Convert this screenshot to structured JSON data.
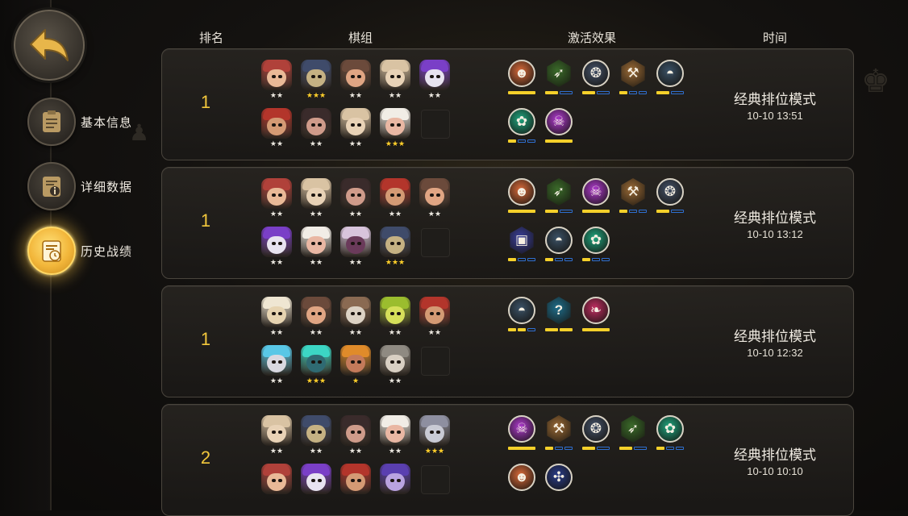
{
  "sidebar": {
    "back_icon": "back-arrow-icon",
    "nav": [
      {
        "label": "基本信息",
        "icon": "clipboard-icon",
        "active": false
      },
      {
        "label": "详细数据",
        "icon": "info-doc-icon",
        "active": false
      },
      {
        "label": "历史战绩",
        "icon": "history-doc-icon",
        "active": true
      }
    ]
  },
  "headers": {
    "rank": "排名",
    "lineup": "棋组",
    "traits": "激活效果",
    "time": "时间"
  },
  "colors": {
    "gold": "#f2c73c",
    "bar_active": "#f5d02a",
    "bar_inactive": "#2f6fd0"
  },
  "records": [
    {
      "rank": "1",
      "mode": "经典排位模式",
      "time": "10-10 13:51",
      "heroes": [
        {
          "name": "goggles-dwarf",
          "stars": 2,
          "skin": "#e9b997",
          "hat": "#b0413a"
        },
        {
          "name": "hooded-assassin",
          "stars": 3,
          "skin": "#c5b183",
          "hat": "#3f4b6a"
        },
        {
          "name": "horned-brute",
          "stars": 2,
          "skin": "#e0a583",
          "hat": "#6b4a3b"
        },
        {
          "name": "red-masked-monk",
          "stars": 2,
          "skin": "#e8d2b6",
          "hat": "#d9c3a3"
        },
        {
          "name": "purple-witch",
          "stars": 2,
          "skin": "#e8e3f0",
          "hat": "#7a3fc7"
        },
        {
          "name": "bearded-pirate",
          "stars": 2,
          "skin": "#d49a74",
          "hat": "#b3352b"
        },
        {
          "name": "dark-rogue",
          "stars": 2,
          "skin": "#cf9b8a",
          "hat": "#3a2b2b"
        },
        {
          "name": "red-masked-monk",
          "stars": 2,
          "skin": "#e8d2b6",
          "hat": "#d9c3a3"
        },
        {
          "name": "white-elder",
          "stars": 3,
          "skin": "#e9b7a3",
          "hat": "#f1ede6"
        },
        {
          "name": "empty",
          "stars": 0
        }
      ],
      "traits": [
        {
          "name": "orc-trait-icon",
          "bg": "#d86a3a",
          "shape": "circle",
          "active": 1,
          "total": 1
        },
        {
          "name": "bow-trait-icon",
          "bg": "#3b6b2a",
          "shape": "hex",
          "active": 1,
          "total": 2
        },
        {
          "name": "paw-print-trait-icon",
          "bg": "#445269",
          "shape": "circle",
          "active": 1,
          "total": 2
        },
        {
          "name": "axe-trait-icon",
          "bg": "#9a6a36",
          "shape": "hex",
          "active": 1,
          "total": 3
        },
        {
          "name": "shield-helm-trait-icon",
          "bg": "#3a5166",
          "shape": "circle",
          "active": 1,
          "total": 2
        },
        {
          "name": "beast-paw-trait-icon",
          "bg": "#1fa67f",
          "shape": "circle",
          "active": 1,
          "total": 3
        },
        {
          "name": "demon-trait-icon",
          "bg": "#b03ad0",
          "shape": "circle",
          "active": 1,
          "total": 1
        }
      ]
    },
    {
      "rank": "1",
      "mode": "经典排位模式",
      "time": "10-10 13:12",
      "heroes": [
        {
          "name": "goggles-dwarf",
          "stars": 2,
          "skin": "#e9b997",
          "hat": "#b0413a"
        },
        {
          "name": "red-masked-monk",
          "stars": 2,
          "skin": "#e8d2b6",
          "hat": "#d9c3a3"
        },
        {
          "name": "dark-rogue",
          "stars": 2,
          "skin": "#cf9b8a",
          "hat": "#3a2b2b"
        },
        {
          "name": "bearded-pirate",
          "stars": 2,
          "skin": "#d49a74",
          "hat": "#b3352b"
        },
        {
          "name": "horned-brute",
          "stars": 2,
          "skin": "#e0a583",
          "hat": "#6b4a3b"
        },
        {
          "name": "purple-witch",
          "stars": 2,
          "skin": "#e8e3f0",
          "hat": "#7a3fc7"
        },
        {
          "name": "white-elder",
          "stars": 2,
          "skin": "#e9b7a3",
          "hat": "#f1ede6"
        },
        {
          "name": "masked-shade",
          "stars": 2,
          "skin": "#6a3a5a",
          "hat": "#d8c4dc"
        },
        {
          "name": "hooded-assassin",
          "stars": 3,
          "skin": "#c5b183",
          "hat": "#3f4b6a"
        },
        {
          "name": "empty",
          "stars": 0
        }
      ],
      "traits": [
        {
          "name": "orc-trait-icon",
          "bg": "#d86a3a",
          "shape": "circle",
          "active": 1,
          "total": 1
        },
        {
          "name": "bow-trait-icon",
          "bg": "#3b6b2a",
          "shape": "hex",
          "active": 1,
          "total": 2
        },
        {
          "name": "demon-trait-icon",
          "bg": "#b03ad0",
          "shape": "circle",
          "active": 1,
          "total": 1
        },
        {
          "name": "axe-trait-icon",
          "bg": "#9a6a36",
          "shape": "hex",
          "active": 1,
          "total": 3
        },
        {
          "name": "paw-print-trait-icon",
          "bg": "#445269",
          "shape": "circle",
          "active": 1,
          "total": 2
        },
        {
          "name": "mage-tome-trait-icon",
          "bg": "#3a3f9a",
          "shape": "hex",
          "active": 1,
          "total": 3
        },
        {
          "name": "shield-helm-trait-icon",
          "bg": "#3a5166",
          "shape": "circle",
          "active": 1,
          "total": 3
        },
        {
          "name": "beast-paw-trait-icon",
          "bg": "#1fa67f",
          "shape": "circle",
          "active": 1,
          "total": 3
        }
      ]
    },
    {
      "rank": "1",
      "mode": "经典排位模式",
      "time": "10-10 12:32",
      "heroes": [
        {
          "name": "white-sage",
          "stars": 2,
          "skin": "#e6d3b0",
          "hat": "#efe6d2"
        },
        {
          "name": "horned-brute",
          "stars": 2,
          "skin": "#e0a583",
          "hat": "#6b4a3b"
        },
        {
          "name": "bull-skull",
          "stars": 2,
          "skin": "#dcd2c4",
          "hat": "#8a6a52"
        },
        {
          "name": "green-frog",
          "stars": 2,
          "skin": "#d6e05a",
          "hat": "#9bbd2e"
        },
        {
          "name": "bearded-pirate",
          "stars": 2,
          "skin": "#d49a74",
          "hat": "#b3352b"
        },
        {
          "name": "frost-yeti",
          "stars": 2,
          "skin": "#d8d8e0",
          "hat": "#59c7e6"
        },
        {
          "name": "crystal-knight",
          "stars": 3,
          "skin": "#2f6a72",
          "hat": "#3cd6c4"
        },
        {
          "name": "tribal-shaman",
          "stars": 1,
          "skin": "#c47a5a",
          "hat": "#e08b2a"
        },
        {
          "name": "old-tiger",
          "stars": 2,
          "skin": "#d8cfc3",
          "hat": "#8f8a82"
        },
        {
          "name": "empty",
          "stars": 0
        }
      ],
      "traits": [
        {
          "name": "shield-helm-trait-icon",
          "bg": "#3a5166",
          "shape": "circle",
          "active": 2,
          "total": 3
        },
        {
          "name": "mystery-trait-icon",
          "bg": "#1f6d8a",
          "shape": "hex",
          "active": 2,
          "total": 2
        },
        {
          "name": "feather-trait-icon",
          "bg": "#c12e62",
          "shape": "circle",
          "active": 1,
          "total": 1
        }
      ]
    },
    {
      "rank": "2",
      "mode": "经典排位模式",
      "time": "10-10 10:10",
      "heroes": [
        {
          "name": "red-masked-monk",
          "stars": 2,
          "skin": "#e8d2b6",
          "hat": "#d9c3a3"
        },
        {
          "name": "hooded-assassin",
          "stars": 2,
          "skin": "#c5b183",
          "hat": "#3f4b6a"
        },
        {
          "name": "dark-rogue",
          "stars": 2,
          "skin": "#cf9b8a",
          "hat": "#3a2b2b"
        },
        {
          "name": "white-elder",
          "stars": 2,
          "skin": "#e9b7a3",
          "hat": "#f1ede6"
        },
        {
          "name": "armored-beast",
          "stars": 3,
          "skin": "#c9cad4",
          "hat": "#8e8fa0"
        },
        {
          "name": "goggles-dwarf",
          "stars": 0,
          "skin": "#e9b997",
          "hat": "#b0413a"
        },
        {
          "name": "purple-witch",
          "stars": 0,
          "skin": "#e8e3f0",
          "hat": "#7a3fc7"
        },
        {
          "name": "bearded-pirate",
          "stars": 0,
          "skin": "#d49a74",
          "hat": "#b3352b"
        },
        {
          "name": "violet-golem",
          "stars": 0,
          "skin": "#b9a3e0",
          "hat": "#5a3fb0"
        },
        {
          "name": "empty",
          "stars": 0
        }
      ],
      "traits": [
        {
          "name": "demon-trait-icon",
          "bg": "#b03ad0",
          "shape": "circle",
          "active": 1,
          "total": 1
        },
        {
          "name": "axe-trait-icon",
          "bg": "#9a6a36",
          "shape": "hex",
          "active": 1,
          "total": 3
        },
        {
          "name": "paw-print-trait-icon",
          "bg": "#445269",
          "shape": "circle",
          "active": 1,
          "total": 2
        },
        {
          "name": "bow-trait-icon",
          "bg": "#3b6b2a",
          "shape": "hex",
          "active": 1,
          "total": 2
        },
        {
          "name": "beast-paw-trait-icon",
          "bg": "#1fa67f",
          "shape": "circle",
          "active": 1,
          "total": 3
        },
        {
          "name": "orc-trait-icon",
          "bg": "#d86a3a",
          "shape": "circle",
          "active": 0,
          "total": 0
        },
        {
          "name": "fish-bone-trait-icon",
          "bg": "#2a3c8a",
          "shape": "circle",
          "active": 0,
          "total": 0
        }
      ]
    }
  ]
}
